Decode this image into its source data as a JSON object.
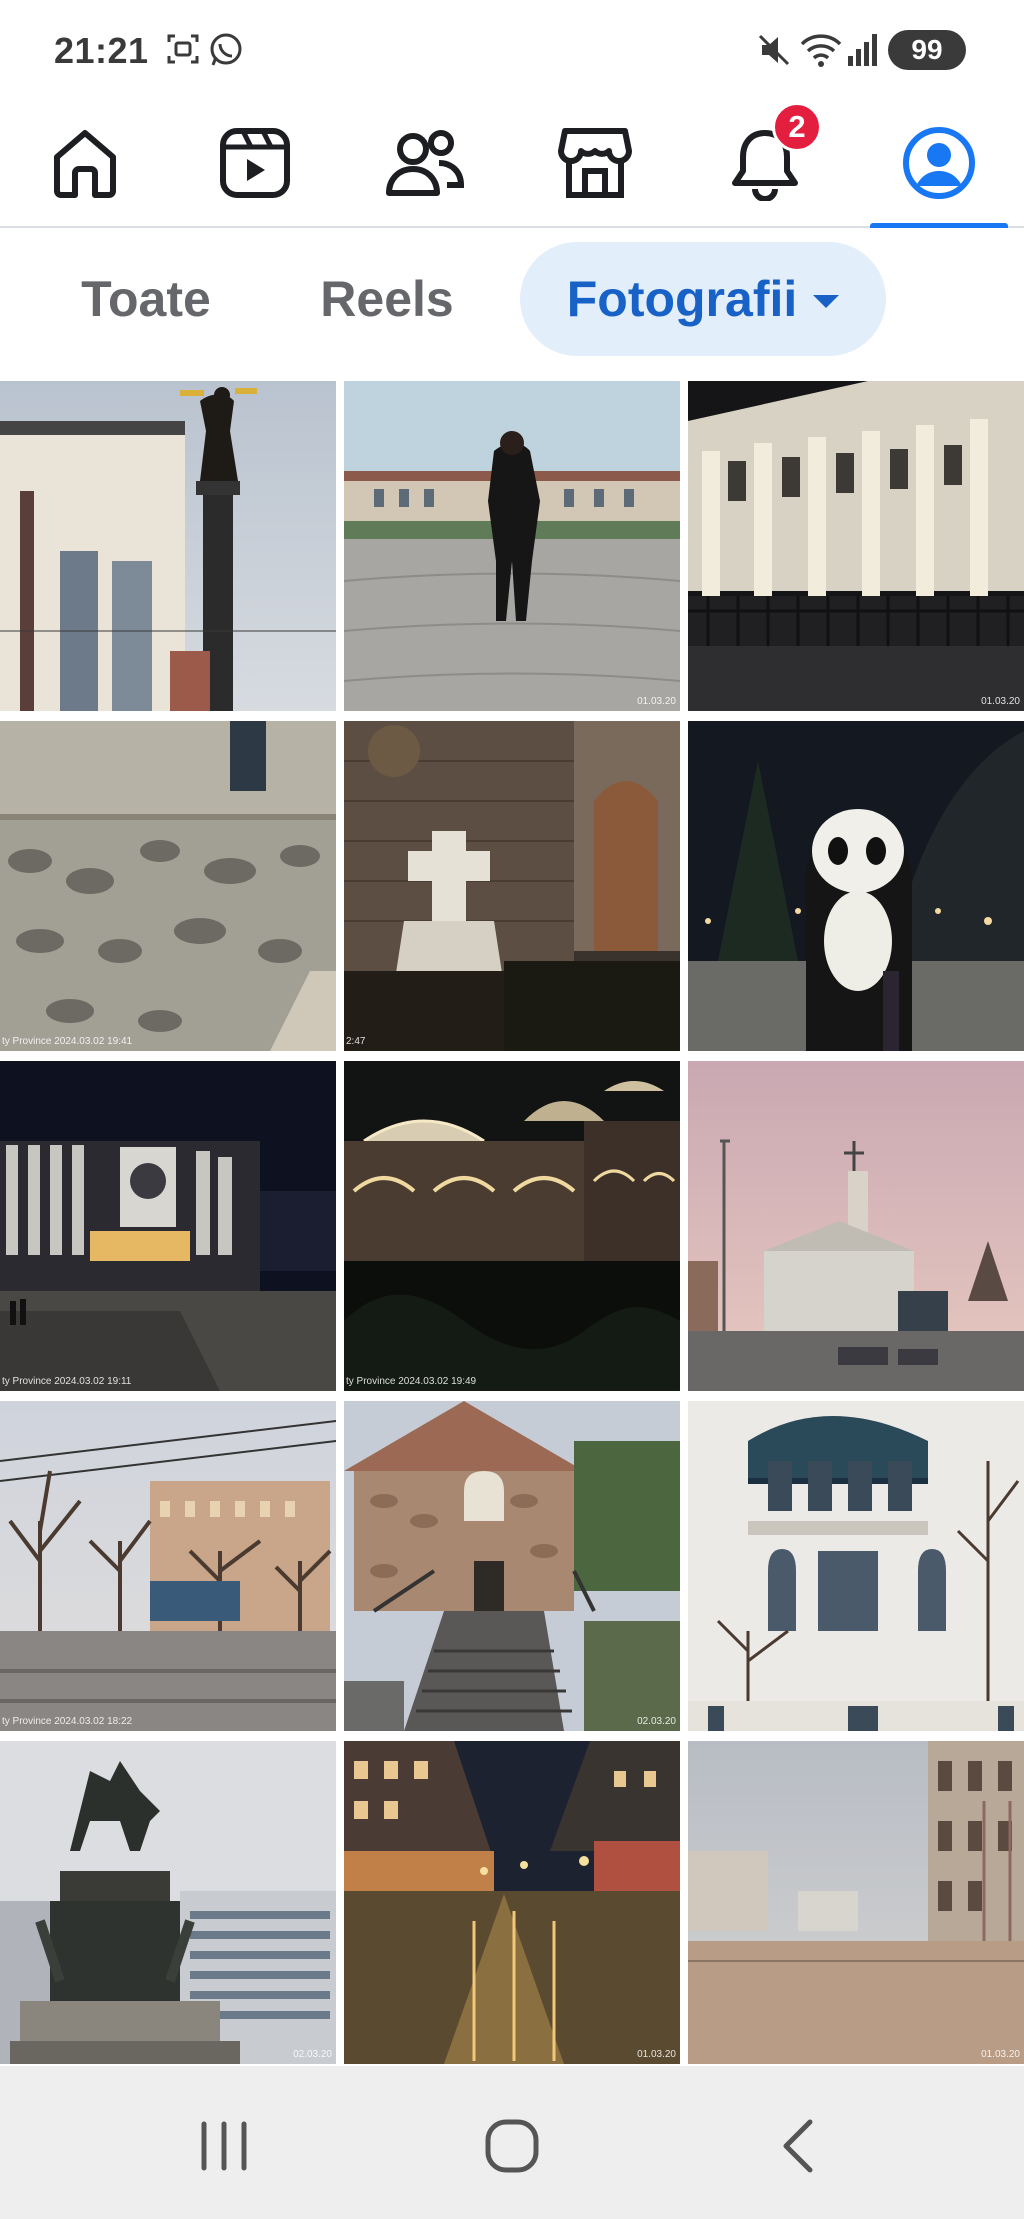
{
  "status_bar": {
    "time": "21:21",
    "battery": "99",
    "icons": [
      "screenshot-icon",
      "whatsapp-icon",
      "mute-icon",
      "wifi-icon",
      "signal-icon",
      "battery-icon"
    ]
  },
  "nav": {
    "items": [
      {
        "name": "home",
        "icon": "home-icon"
      },
      {
        "name": "reels",
        "icon": "video-icon"
      },
      {
        "name": "friends",
        "icon": "friends-icon"
      },
      {
        "name": "marketplace",
        "icon": "marketplace-icon"
      },
      {
        "name": "notifications",
        "icon": "bell-icon",
        "badge": "2"
      },
      {
        "name": "profile",
        "icon": "profile-icon",
        "active": true
      }
    ],
    "accent": "#1877f2",
    "badge_color": "#e41e3f"
  },
  "tabs": [
    {
      "label": "Toate"
    },
    {
      "label": "Reels"
    },
    {
      "label": "Fotografii",
      "selected": true
    }
  ],
  "photos": [
    {
      "scene": "statue-column",
      "stamp": ""
    },
    {
      "scene": "woman-square",
      "stamp": "01.03.20"
    },
    {
      "scene": "night-building",
      "stamp": "01.03.20"
    },
    {
      "scene": "stone-wall",
      "stamp": "ty Province 2024.03.02 19:41"
    },
    {
      "scene": "church-cross",
      "stamp": "2:47"
    },
    {
      "scene": "panda-park",
      "stamp": ""
    },
    {
      "scene": "ndk-night",
      "stamp": "ty Province 2024.03.02 19:11"
    },
    {
      "scene": "lit-church",
      "stamp": "ty Province 2024.03.02 19:49"
    },
    {
      "scene": "sunset-church",
      "stamp": ""
    },
    {
      "scene": "trees-tram",
      "stamp": "ty Province 2024.03.02 18:22"
    },
    {
      "scene": "small-church",
      "stamp": "02.03.20"
    },
    {
      "scene": "white-house",
      "stamp": ""
    },
    {
      "scene": "equestrian",
      "stamp": "02.03.20"
    },
    {
      "scene": "wet-street",
      "stamp": "01.03.20"
    },
    {
      "scene": "boulevard",
      "stamp": "01.03.20"
    }
  ],
  "system_nav": {
    "icons": [
      "recents-icon",
      "home-button-icon",
      "back-icon"
    ]
  }
}
